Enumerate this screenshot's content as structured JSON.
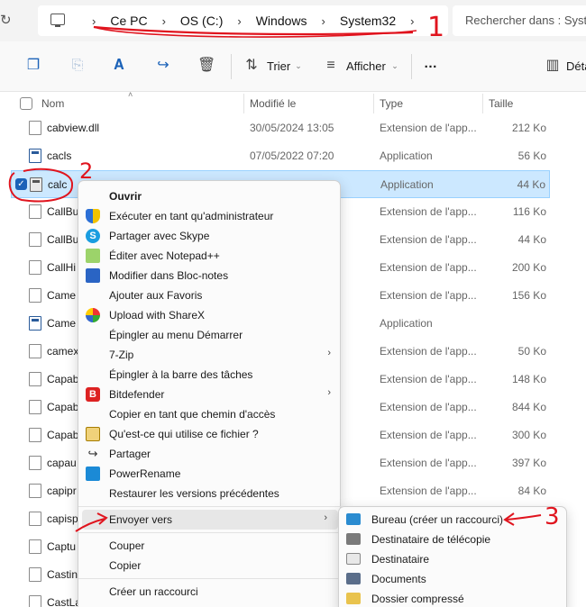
{
  "address_bar": {
    "crumbs": [
      "Ce PC",
      "OS (C:)",
      "Windows",
      "System32"
    ],
    "search_placeholder": "Rechercher dans : Syst"
  },
  "toolbar": {
    "sort_label": "Trier",
    "view_label": "Afficher",
    "more_label": "…",
    "details_label": "Déta"
  },
  "columns": {
    "name": "Nom",
    "modified": "Modifié le",
    "type": "Type",
    "size": "Taille"
  },
  "files": [
    {
      "name": "cabview.dll",
      "modified": "30/05/2024 13:05",
      "type": "Extension de l'app...",
      "size": "212 Ko",
      "icon": "dll"
    },
    {
      "name": "cacls",
      "modified": "07/05/2022 07:20",
      "type": "Application",
      "size": "56 Ko",
      "icon": "app"
    },
    {
      "name": "calc",
      "modified": "",
      "type": "Application",
      "size": "44 Ko",
      "icon": "calc",
      "selected": true
    },
    {
      "name": "CallBu",
      "modified": "",
      "type": "Extension de l'app...",
      "size": "116 Ko",
      "icon": "dll"
    },
    {
      "name": "CallBu",
      "modified": "",
      "type": "Extension de l'app...",
      "size": "44 Ko",
      "icon": "dll"
    },
    {
      "name": "CallHi",
      "modified": "",
      "type": "Extension de l'app...",
      "size": "200 Ko",
      "icon": "dll"
    },
    {
      "name": "Came",
      "modified": "",
      "type": "Extension de l'app...",
      "size": "156 Ko",
      "icon": "dll"
    },
    {
      "name": "Came",
      "modified": "",
      "type": "Application",
      "size": "",
      "icon": "app"
    },
    {
      "name": "camex",
      "modified": "",
      "type": "Extension de l'app...",
      "size": "50 Ko",
      "icon": "dll"
    },
    {
      "name": "Capab",
      "modified": "",
      "type": "Extension de l'app...",
      "size": "148 Ko",
      "icon": "dll"
    },
    {
      "name": "Capab",
      "modified": "",
      "type": "Extension de l'app...",
      "size": "844 Ko",
      "icon": "dll"
    },
    {
      "name": "Capab",
      "modified": "",
      "type": "Extension de l'app...",
      "size": "300 Ko",
      "icon": "dll"
    },
    {
      "name": "capau",
      "modified": "",
      "type": "Extension de l'app...",
      "size": "397 Ko",
      "icon": "dll"
    },
    {
      "name": "capipr",
      "modified": "",
      "type": "Extension de l'app...",
      "size": "84 Ko",
      "icon": "dll"
    },
    {
      "name": "capisp",
      "modified": "",
      "type": "",
      "size": "",
      "icon": "dll"
    },
    {
      "name": "Captu",
      "modified": "",
      "type": "",
      "size": "",
      "icon": "dll"
    },
    {
      "name": "Castin",
      "modified": "",
      "type": "",
      "size": "",
      "icon": "dll"
    },
    {
      "name": "CastLa",
      "modified": "",
      "type": "",
      "size": "",
      "icon": "dll"
    }
  ],
  "context_menu": {
    "items": [
      {
        "label": "Ouvrir",
        "icon": "none",
        "bold": true
      },
      {
        "label": "Exécuter en tant qu'administrateur",
        "icon": "shield-icon"
      },
      {
        "label": "Partager avec Skype",
        "icon": "skype-icon",
        "glyph": "S"
      },
      {
        "label": "Éditer avec Notepad++",
        "icon": "notepadpp-icon"
      },
      {
        "label": "Modifier dans Bloc-notes",
        "icon": "notepad-icon"
      },
      {
        "label": "Ajouter aux Favoris",
        "icon": "none"
      },
      {
        "label": "Upload with ShareX",
        "icon": "sharex-icon"
      },
      {
        "label": "Épingler au menu Démarrer",
        "icon": "none"
      },
      {
        "label": "7-Zip",
        "icon": "none",
        "submenu": true
      },
      {
        "label": "Épingler à la barre des tâches",
        "icon": "none"
      },
      {
        "label": "Bitdefender",
        "icon": "bitdefender-icon",
        "glyph": "B",
        "submenu": true
      },
      {
        "label": "Copier en tant que chemin d'accès",
        "icon": "none"
      },
      {
        "label": "Qu'est-ce qui utilise ce fichier ?",
        "icon": "lock-icon"
      },
      {
        "label": "Partager",
        "icon": "share-icon",
        "glyph": "↪"
      },
      {
        "label": "PowerRename",
        "icon": "powerrename-icon"
      },
      {
        "label": "Restaurer les versions précédentes",
        "icon": "none"
      },
      {
        "label": "Envoyer vers",
        "icon": "none",
        "submenu": true,
        "highlighted": true
      },
      {
        "label": "Couper",
        "icon": "none"
      },
      {
        "label": "Copier",
        "icon": "none"
      },
      {
        "label": "Créer un raccourci",
        "icon": "none"
      }
    ]
  },
  "sendto_menu": {
    "items": [
      {
        "label": "Bureau (créer un raccourci)",
        "icon": "desktop-icon"
      },
      {
        "label": "Destinataire de télécopie",
        "icon": "fax-icon"
      },
      {
        "label": "Destinataire",
        "icon": "mail-icon"
      },
      {
        "label": "Documents",
        "icon": "documents-icon"
      },
      {
        "label": "Dossier compressé",
        "icon": "zip-folder-icon"
      }
    ]
  },
  "annotations": {
    "step1": "1",
    "step2": "2",
    "step3": "3"
  },
  "colors": {
    "annotation_red": "#e0141e",
    "selection_bg": "#cce8ff",
    "accent": "#1b62b8"
  }
}
